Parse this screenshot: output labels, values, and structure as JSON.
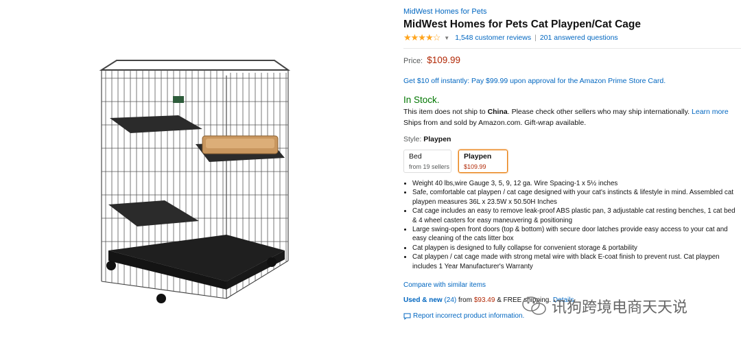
{
  "product": {
    "brand": "MidWest Homes for Pets",
    "title": "MidWest Homes for Pets Cat Playpen/Cat Cage",
    "rating_stars": "★★★★☆",
    "rating_value": 4,
    "reviews_link": "1,548 customer reviews",
    "separator": "|",
    "questions_link": "201 answered questions"
  },
  "price": {
    "label": "Price:",
    "amount": "$109.99"
  },
  "promo": "Get $10 off instantly: Pay $99.99 upon approval for the Amazon Prime Store Card.",
  "stock": {
    "status": "In Stock.",
    "ship_prefix": "This item does not ship to ",
    "ship_country": "China",
    "ship_suffix": ". Please check other sellers who may ship internationally. ",
    "learn_more": "Learn more",
    "sold_by": "Ships from and sold by Amazon.com. Gift-wrap available."
  },
  "style": {
    "label": "Style:",
    "selected": "Playpen",
    "options": [
      {
        "name": "Bed",
        "sub": "from 19 sellers"
      },
      {
        "name": "Playpen",
        "sub": "$109.99"
      }
    ]
  },
  "bullets": [
    "Weight 40 lbs,wire Gauge 3, 5, 9, 12 ga. Wire Spacing-1 x 5½ inches",
    "Safe, comfortable cat playpen / cat cage designed with your cat's instincts & lifestyle in mind. Assembled cat playpen measures 36L x 23.5W x 50.50H Inches",
    "Cat cage includes an easy to remove leak-proof ABS plastic pan, 3 adjustable cat resting benches, 1 cat bed & 4 wheel casters for easy maneuvering & positioning",
    "Large swing-open front doors (top & bottom) with secure door latches provide easy access to your cat and easy cleaning of the cats litter box",
    "Cat playpen is designed to fully collapse for convenient storage & portability",
    "Cat playpen / cat cage made with strong metal wire with black E-coat finish to prevent rust. Cat playpen includes 1 Year Manufacturer's Warranty"
  ],
  "compare_link": "Compare with similar items",
  "used_new": {
    "link": "Used & new",
    "count": "(24)",
    "from": " from ",
    "price": "$93.49",
    "shipping": " & FREE shipping. ",
    "details": "Details"
  },
  "report_link": "Report incorrect product information.",
  "watermark": "讯狗跨境电商天天说",
  "colors": {
    "link": "#0066c0",
    "price": "#b12704",
    "in_stock": "#007600",
    "star": "#ffa41c",
    "selected_border": "#e77600"
  },
  "icons": [
    "star-rating-icon",
    "chevron-down-icon",
    "report-bubble-icon",
    "wechat-icon"
  ]
}
